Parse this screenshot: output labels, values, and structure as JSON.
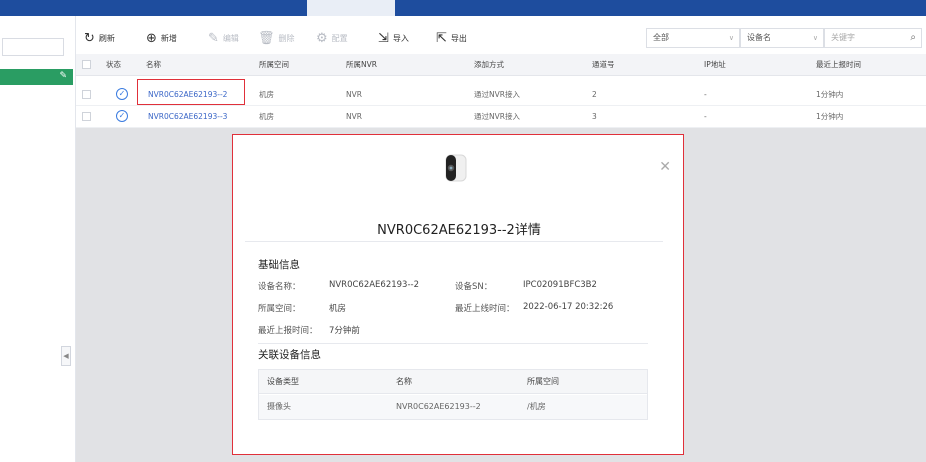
{
  "toolbar": {
    "refresh": "刷新",
    "add": "新增",
    "edit": "编辑",
    "delete": "删除",
    "config": "配置",
    "import": "导入",
    "export": "导出",
    "filter_all": "全部",
    "filter_field": "设备名",
    "keyword_placeholder": "关键字"
  },
  "table": {
    "headers": [
      "状态",
      "名称",
      "所属空间",
      "所属NVR",
      "添加方式",
      "通道号",
      "IP地址",
      "最近上报时间"
    ],
    "rows": [
      {
        "name": "NVR0C62AE62193--2",
        "space": "机房",
        "nvr": "NVR",
        "method": "通过NVR接入",
        "channel": "2",
        "ip": "-",
        "report": "1分钟内"
      },
      {
        "name": "NVR0C62AE62193--3",
        "space": "机房",
        "nvr": "NVR",
        "method": "通过NVR接入",
        "channel": "3",
        "ip": "-",
        "report": "1分钟内"
      }
    ]
  },
  "modal": {
    "title": "NVR0C62AE62193--2详情",
    "basic_section": "基础信息",
    "device_name_label": "设备名称：",
    "device_name": "NVR0C62AE62193--2",
    "sn_label": "设备SN：",
    "sn": "IPC02091BFC3B2",
    "space_label": "所属空间：",
    "space": "机房",
    "online_label": "最近上线时间：",
    "online": "2022-06-17 20:32:26",
    "report_label": "最近上报时间：",
    "report": "7分钟前",
    "related_section": "关联设备信息",
    "related_headers": [
      "设备类型",
      "名称",
      "所属空间"
    ],
    "related_rows": [
      {
        "type": "摄像头",
        "name": "NVR0C62AE62193--2",
        "space": "/机房"
      }
    ]
  },
  "colors": {
    "topbar": "#1e4d9e",
    "accent_green": "#2a9d63",
    "link_blue": "#3a66c7",
    "highlight_red": "#e0303a"
  }
}
